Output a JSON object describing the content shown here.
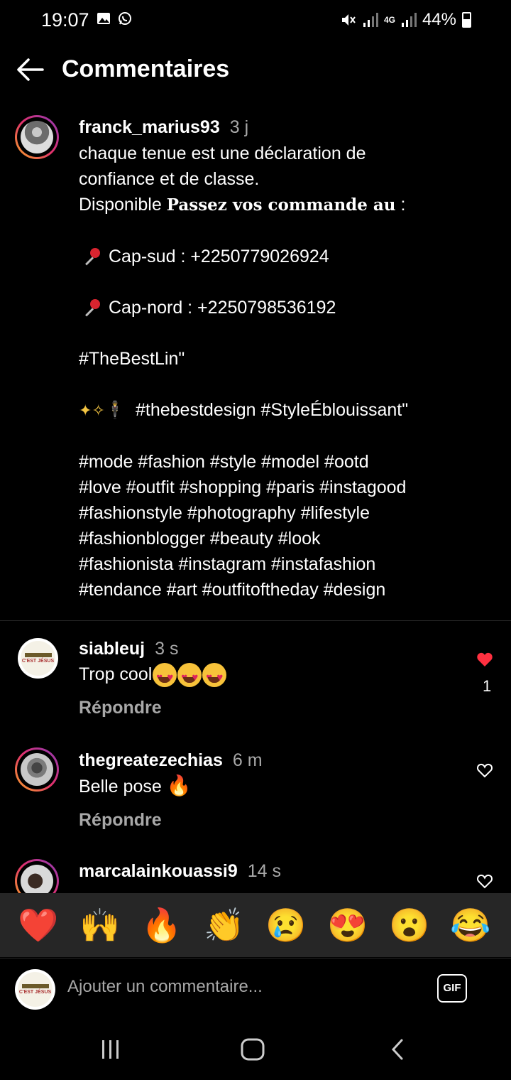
{
  "status_bar": {
    "time": "19:07",
    "battery": "44%",
    "network": "4G"
  },
  "header": {
    "title": "Commentaires"
  },
  "post": {
    "username": "franck_marius93",
    "age": "3 j",
    "lines": {
      "l1": "chaque tenue est une déclaration de",
      "l2": "confiance et de classe.",
      "l3a": "Disponible ",
      "l3b": "Passez vos commande au",
      "l3c": " :",
      "capsud": "Cap-sud : +2250779026924",
      "capnord": "Cap-nord : +2250798536192",
      "tag1": "#TheBestLin\"",
      "tag2": "#thebestdesign #StyleÉblouissant\"",
      "h1": "#mode #fashion #style #model #ootd",
      "h2": "#love #outfit #shopping #paris #instagood",
      "h3": "#fashionstyle #photography #lifestyle",
      "h4": "#fashionblogger #beauty #look",
      "h5": "#fashionista #instagram #instafashion",
      "h6": "#tendance #art #outfitoftheday #design"
    }
  },
  "comments": [
    {
      "username": "siableuj",
      "age": "3 s",
      "text": "Trop cool",
      "reply": "Répondre",
      "likes": "1",
      "liked": true
    },
    {
      "username": "thegreatezechias",
      "age": "6 m",
      "text": "Belle pose ",
      "reply": "Répondre",
      "liked": false
    },
    {
      "username": "marcalainkouassi9",
      "age": "14 s",
      "liked": false
    }
  ],
  "avatar_text": {
    "label": "C'EST JÉSUS"
  },
  "emoji_bar": [
    "❤️",
    "🙌",
    "🔥",
    "👏",
    "😢",
    "😍",
    "😮",
    "😂"
  ],
  "input": {
    "placeholder": "Ajouter un commentaire...",
    "gif_label": "GIF"
  },
  "colors": {
    "background": "#000000",
    "secondary_text": "#a8a8a8",
    "like_red": "#ff3040",
    "emoji_bar_bg": "#262626"
  }
}
